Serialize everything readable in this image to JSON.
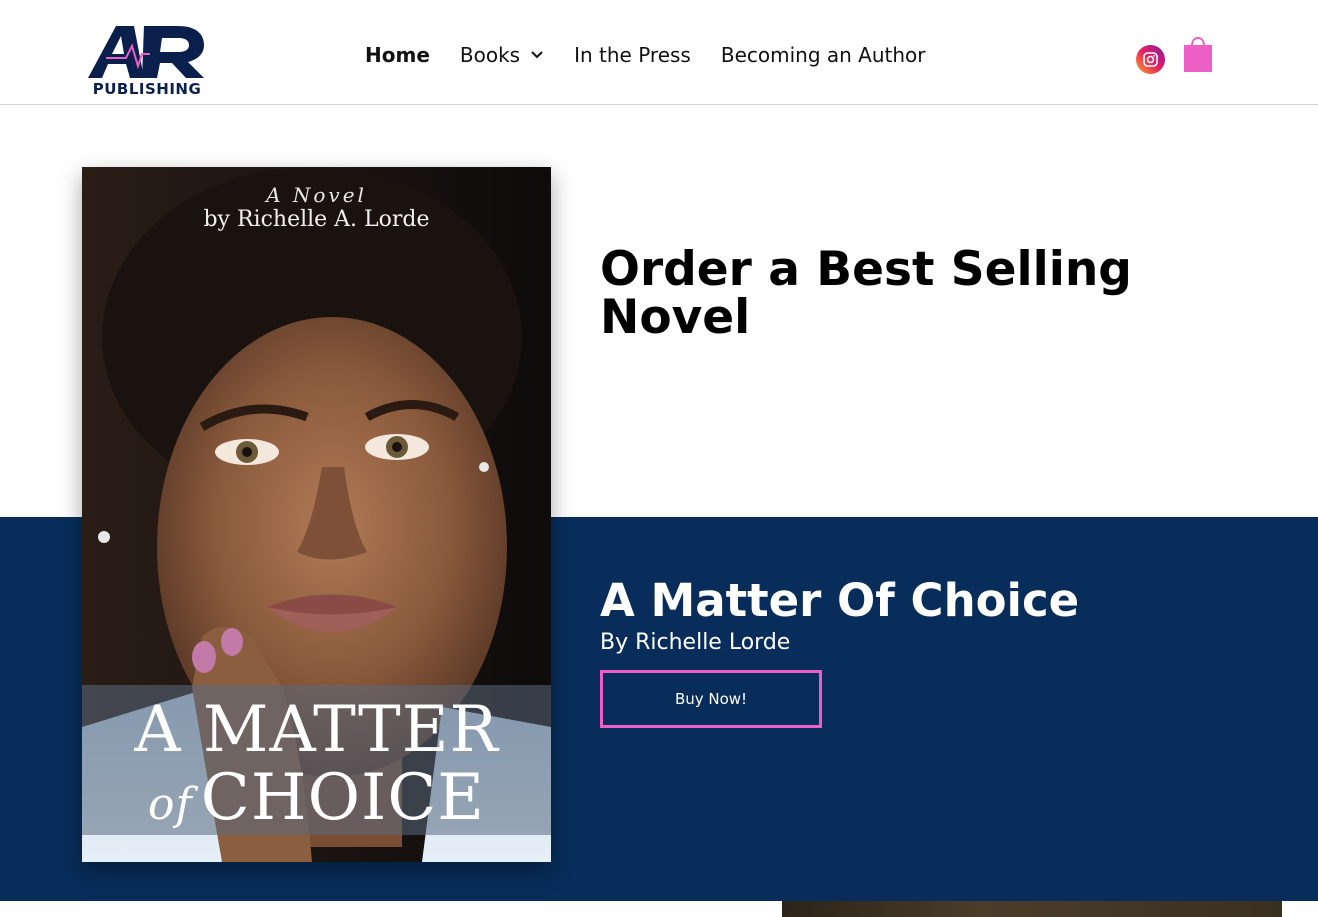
{
  "header": {
    "logo": {
      "monogram": "AR",
      "wordmark": "PUBLISHING",
      "colors": {
        "navy": "#0b1f4d",
        "pink": "#ec5fc4"
      }
    },
    "nav": [
      {
        "label": "Home",
        "active": true
      },
      {
        "label": "Books",
        "has_dropdown": true
      },
      {
        "label": "In the Press"
      },
      {
        "label": "Becoming an Author"
      }
    ],
    "icons": {
      "social": "instagram-icon",
      "cart": "shopping-bag-icon",
      "cart_color": "#ec5fc4"
    }
  },
  "hero": {
    "headline": "Order a Best Selling Novel",
    "band_color": "#082d5a",
    "book": {
      "title": "A Matter Of Choice",
      "author_line": "By Richelle Lorde",
      "button_label": "Buy Now!",
      "button_border_color": "#ec5fc4",
      "cover": {
        "kicker": "A Novel",
        "author": "by Richelle A. Lorde",
        "title_line1": "A MATTER",
        "title_of": "of",
        "title_line2": "CHOICE"
      }
    }
  }
}
